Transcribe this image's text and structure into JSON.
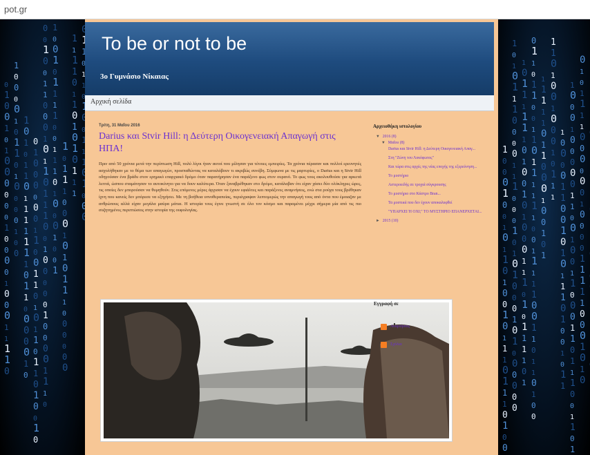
{
  "browser": {
    "url_fragment": "pot.gr"
  },
  "blog": {
    "title": "To be or not to be",
    "description": "3ο Γυμνάσιο Νίκαιας",
    "nav_home": "Αρχική σελίδα"
  },
  "post": {
    "date": "Τρίτη, 31 Μαΐου 2016",
    "title": "Darius και Stvir Hill: η Δεύτερη Οικογενειακή Απαγωγή στις ΗΠΑ!",
    "body": "Πριν από 50 χρόνια μετά την περίπτωση Hill, πολύ λίγοι ήταν αυτοί που μίλησαν για τέτοιες εμπειρίες. Τα χρόνια πέρασαν και πολλοί ερευνητές ασχολήθηκαν με το θέμα των απαγωγών, προσπαθώντας να καταλάβουν τι ακριβώς συνέβη. Σύμφωνα με τις μαρτυρίες, ο Darius και η Stvir Hill οδηγούσαν ένα βράδυ στον ερημικό επαρχιακό δρόμο όταν παρατήρησαν ένα παράξενο φως στον ουρανό. Το φως τους ακολουθούσε για αρκετά λεπτά, ώσπου σταμάτησαν το αυτοκίνητο για να δουν καλύτερα. Όταν ξαναβρέθηκαν στο δρόμο, κατάλαβαν ότι είχαν χάσει δύο ολόκληρες ώρες, τις οποίες δεν μπορούσαν να θυμηθούν. Στις επόμενες μέρες άρχισαν να έχουν εφιάλτες και παράξενες αναμνήσεις, ενώ στα ρούχα τους βρέθηκαν ίχνη που κανείς δεν μπόρεσε να εξηγήσει. Με τη βοήθεια υπνοθεραπείας, περιέγραψαν λεπτομερώς την απαγωγή τους από όντα που έμοιαζαν με ανθρώπους αλλά είχαν μεγάλα μαύρα μάτια. Η ιστορία τους έγινε γνωστή σε όλο τον κόσμο και παραμένει μέχρι σήμερα μία από τις πιο συζητημένες περιπτώσεις στην ιστορία της ουφολογίας."
  },
  "sidebar": {
    "archive_title": "Αρχειοθήκη ιστολογίου",
    "years": [
      {
        "label": "2016 (8)",
        "months": [
          {
            "label": "Μαΐου (8)",
            "posts": [
              "Darius και Stvir Hill: η Δεύτερη Οικογενειακή Απαγ...",
              "Στη \"Ζώνη του Λυκόφωτος\"",
              "Και τώρα στις αρχές της νέας εποχής της εξερεύνηση...",
              "Το μυστήριο",
              "Αστεροειδής σε τροχιά σύγκρουσης",
              "Το μυστήριο στο Κάστρο Bran...",
              "Τα μυστικά που δεν έχουν αποκαλυφθεί",
              "\"ΥΠΑΡΧΕΙ Ή ΟΧΙ;\" ΤΟ ΜΥΣΤΗΡΙΟ ΕΠΑΝΕΡΧΕΤΑΙ..."
            ]
          }
        ]
      },
      {
        "label": "2015 (10)"
      }
    ],
    "follow_title": "Εγγραφή σε",
    "feeds": [
      "Αναρτήσεις",
      "Σχόλια"
    ]
  },
  "icons": {
    "feed": "rss-feed-icon",
    "expand": "triangle-down-icon",
    "collapsed": "triangle-right-icon"
  },
  "colors": {
    "link": "#6a2fd1",
    "page_bg": "#f7c796",
    "header": "#1e4b7e"
  }
}
